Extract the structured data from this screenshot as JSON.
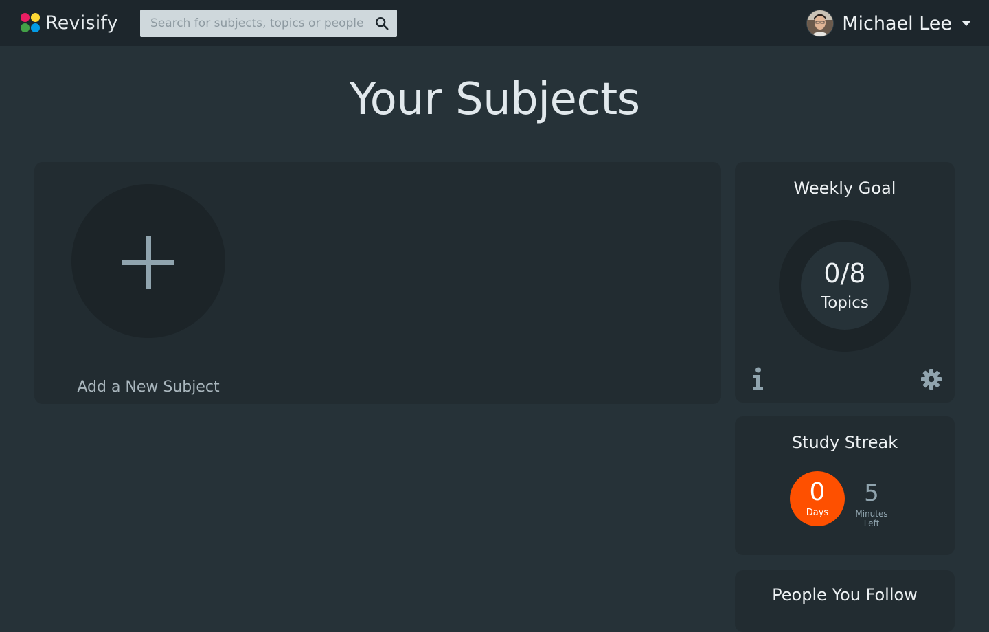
{
  "app": {
    "name": "Revisify",
    "logo_colors": [
      "#e91e63",
      "#fdd835",
      "#43a047",
      "#039be5"
    ]
  },
  "search": {
    "placeholder": "Search for subjects, topics or people",
    "icon": "search-icon"
  },
  "user": {
    "name": "Michael Lee",
    "avatar": "avatar-photo",
    "menu_icon": "caret-down-icon"
  },
  "page": {
    "title": "Your Subjects"
  },
  "subjects": {
    "add_label": "Add a New Subject",
    "add_icon": "plus-icon"
  },
  "weekly_goal": {
    "title": "Weekly Goal",
    "value": "0/8",
    "unit": "Topics",
    "completed": 0,
    "target": 8,
    "info_icon": "info-icon",
    "settings_icon": "gear-icon"
  },
  "study_streak": {
    "title": "Study Streak",
    "days_value": "0",
    "days_label": "Days",
    "minutes_value": "5",
    "minutes_label_line1": "Minutes",
    "minutes_label_line2": "Left",
    "accent_color": "#fe5000"
  },
  "people_you_follow": {
    "title": "People You Follow"
  },
  "colors": {
    "background": "#263238",
    "topbar": "#1d262c",
    "panel": "#222c31",
    "muted_text": "#90a4ae"
  }
}
